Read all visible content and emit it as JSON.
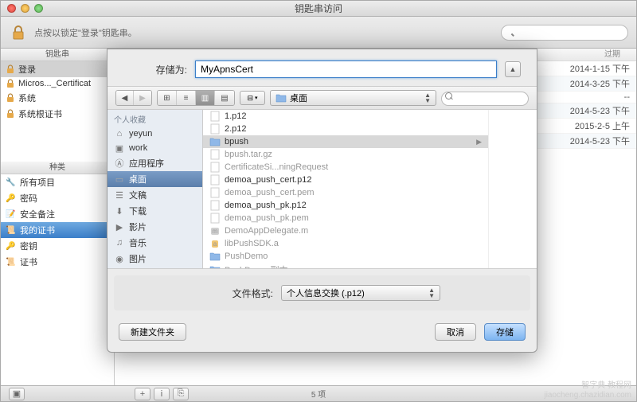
{
  "window": {
    "title": "钥匙串访问",
    "lock_hint": "点按以锁定\"登录\"钥匙串。"
  },
  "left_panel": {
    "keychains_header": "钥匙串",
    "keychains": [
      {
        "label": "登录",
        "selected": true
      },
      {
        "label": "Micros..._Certificat"
      },
      {
        "label": "系统"
      },
      {
        "label": "系统根证书"
      }
    ],
    "categories_header": "种类",
    "categories": [
      {
        "label": "所有项目"
      },
      {
        "label": "密码"
      },
      {
        "label": "安全备注"
      },
      {
        "label": "我的证书",
        "selected": true
      },
      {
        "label": "密钥"
      },
      {
        "label": "证书"
      }
    ]
  },
  "right_panel": {
    "header_date": "过期",
    "rows": [
      {
        "date": "2014-1-15 下午"
      },
      {
        "date": "2014-3-25 下午"
      },
      {
        "date": "--"
      },
      {
        "date": "2014-5-23 下午"
      },
      {
        "date": "2015-2-5 上午"
      },
      {
        "date": "2014-5-23 下午"
      }
    ]
  },
  "sheet": {
    "save_as_label": "存储为:",
    "save_as_value": "MyApnsCert",
    "location_label": "桌面",
    "favorites_header": "个人收藏",
    "favorites": [
      {
        "label": "yeyun",
        "icon": "home"
      },
      {
        "label": "work",
        "icon": "folder"
      },
      {
        "label": "应用程序",
        "icon": "apps"
      },
      {
        "label": "桌面",
        "icon": "desktop",
        "selected": true
      },
      {
        "label": "文稿",
        "icon": "docs"
      },
      {
        "label": "下载",
        "icon": "download"
      },
      {
        "label": "影片",
        "icon": "movies"
      },
      {
        "label": "音乐",
        "icon": "music"
      },
      {
        "label": "图片",
        "icon": "pictures"
      }
    ],
    "files": [
      {
        "label": "1.p12",
        "enabled": true,
        "icon": "cert"
      },
      {
        "label": "2.p12",
        "enabled": true,
        "icon": "cert"
      },
      {
        "label": "bpush",
        "enabled": true,
        "icon": "folder",
        "selected": true,
        "hasChildren": true
      },
      {
        "label": "bpush.tar.gz",
        "enabled": false,
        "icon": "archive"
      },
      {
        "label": "CertificateSi...ningRequest",
        "enabled": false,
        "icon": "cert"
      },
      {
        "label": "demoa_push_cert.p12",
        "enabled": true,
        "icon": "cert"
      },
      {
        "label": "demoa_push_cert.pem",
        "enabled": false,
        "icon": "cert"
      },
      {
        "label": "demoa_push_pk.p12",
        "enabled": true,
        "icon": "cert"
      },
      {
        "label": "demoa_push_pk.pem",
        "enabled": false,
        "icon": "cert"
      },
      {
        "label": "DemoAppDelegate.m",
        "enabled": false,
        "icon": "m"
      },
      {
        "label": "libPushSDK.a",
        "enabled": false,
        "icon": "a"
      },
      {
        "label": "PushDemo",
        "enabled": false,
        "icon": "folder"
      },
      {
        "label": "PushDemo 副本",
        "enabled": false,
        "icon": "folder"
      }
    ],
    "format_label": "文件格式:",
    "format_value": "个人信息交换 (.p12)",
    "new_folder": "新建文件夹",
    "cancel": "取消",
    "save": "存储"
  },
  "statusbar": {
    "items_text": "5 项"
  },
  "watermark": {
    "l1": "智字典 教程网",
    "l2": "jiaocheng.chazidian.com"
  }
}
